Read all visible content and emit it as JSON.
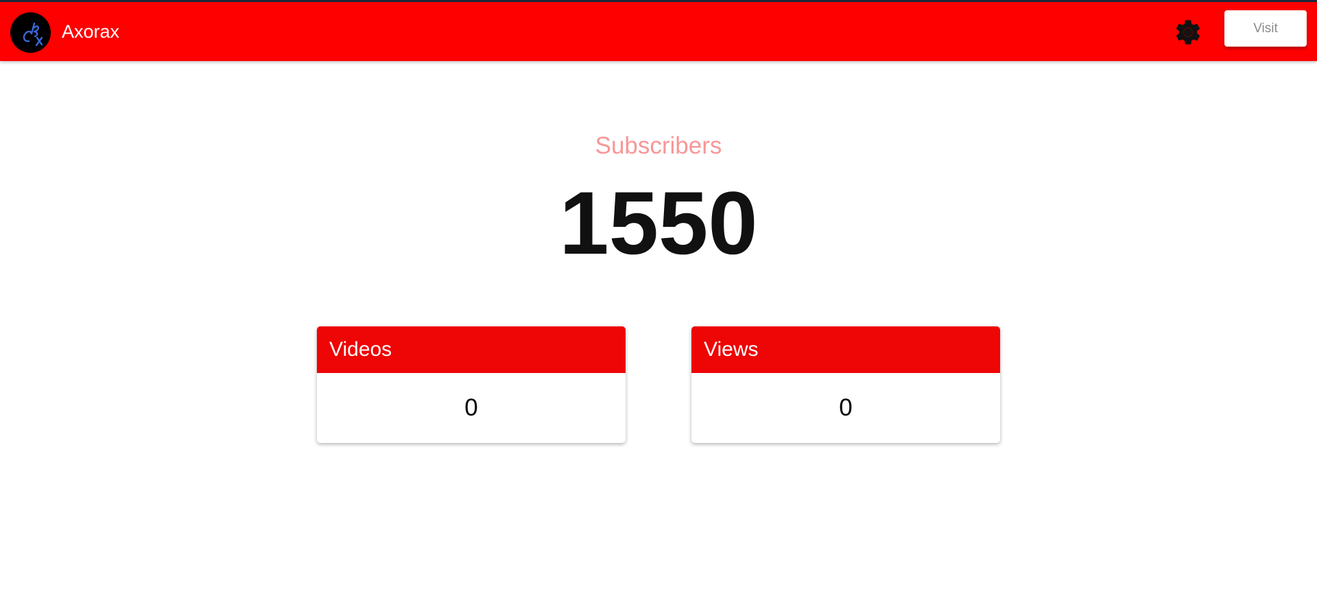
{
  "header": {
    "brand": "Axorax",
    "visit_label": "Visit",
    "settings_icon": "gear-icon",
    "avatar_icon": "logo-icon"
  },
  "main": {
    "subscribers_label": "Subscribers",
    "subscribers_count": "1550",
    "cards": [
      {
        "label": "Videos",
        "value": "0"
      },
      {
        "label": "Views",
        "value": "0"
      }
    ]
  },
  "colors": {
    "header_bg": "#ff0000",
    "card_header_bg": "#ee0505",
    "subscribers_label": "#f89797",
    "avatar_bg": "#000000",
    "logo_stroke": "#3a67d9"
  }
}
